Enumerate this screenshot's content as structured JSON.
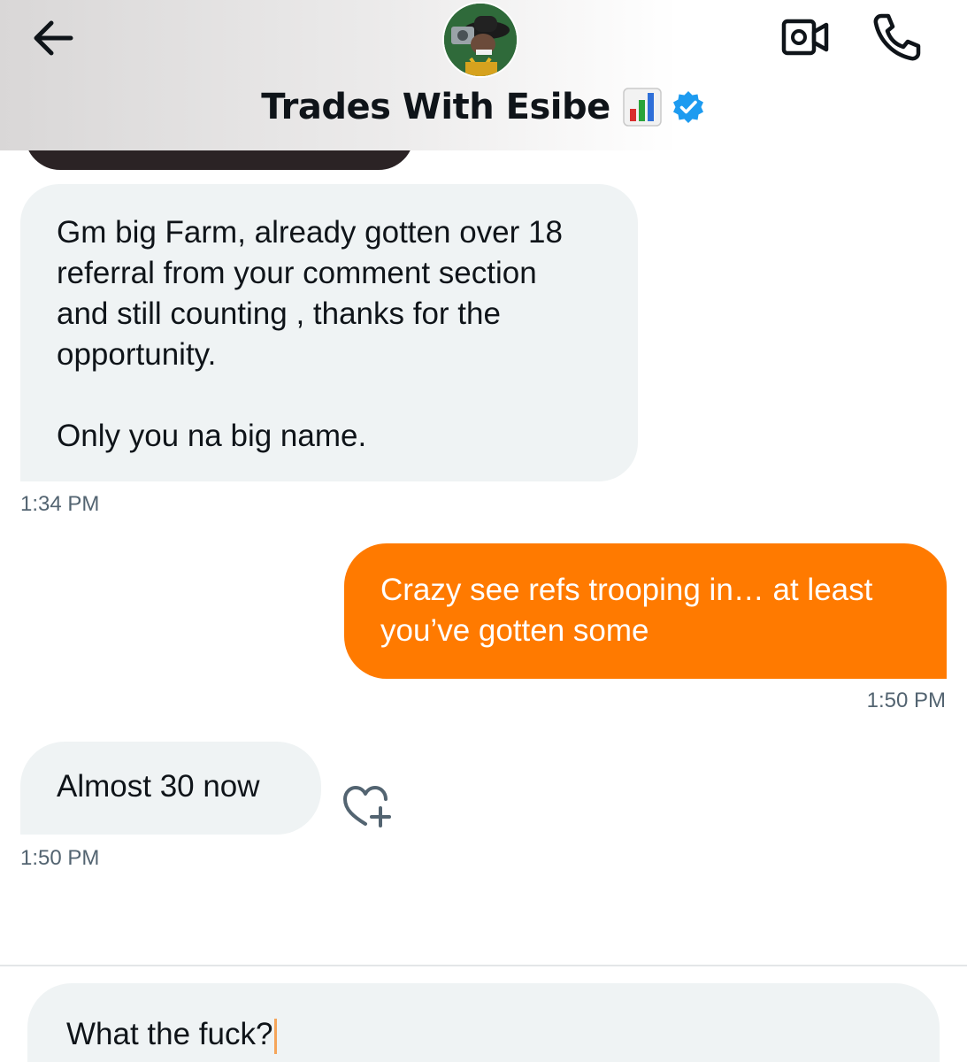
{
  "header": {
    "back_icon": "arrow-left-icon",
    "title": "Trades With Esibe",
    "title_emoji": "bar-chart-icon",
    "verified_icon": "verified-badge-icon",
    "video_icon": "video-camera-icon",
    "call_icon": "phone-icon",
    "verified_color": "#1d9bf0"
  },
  "messages": [
    {
      "direction": "incoming",
      "text": "Gm big Farm, already gotten over 18\nreferral from your comment section\nand still counting , thanks for the\nopportunity.\n\nOnly you na big name.",
      "time": "1:34 PM"
    },
    {
      "direction": "outgoing",
      "text": "Crazy see refs trooping in… at least\nyou’ve gotten some",
      "time": "1:50 PM"
    },
    {
      "direction": "incoming",
      "text": "Almost 30 now",
      "time": "1:50 PM",
      "reaction_icon": "add-reaction-heart-icon"
    }
  ],
  "composer": {
    "value": "What the fuck?"
  },
  "colors": {
    "outgoing_bubble": "#ff7a00",
    "incoming_bubble": "#eff3f4",
    "timestamp": "#536471"
  }
}
